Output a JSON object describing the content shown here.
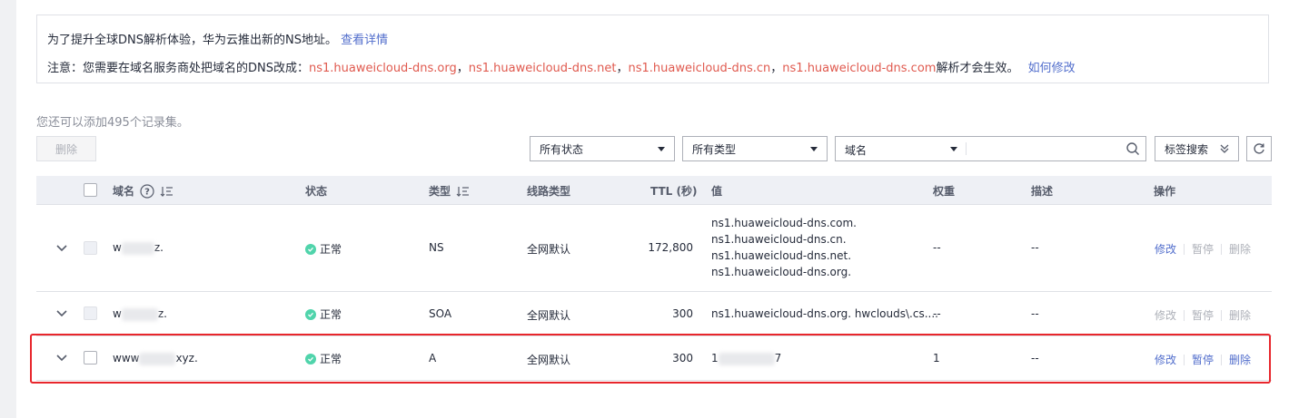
{
  "notice": {
    "line1_text": "为了提升全球DNS解析体验，华为云推出新的NS地址。",
    "line1_link": "查看详情",
    "line2_prefix": "注意：您需要在域名服务商处把域名的DNS改成：",
    "ns_servers": [
      "ns1.huaweicloud-dns.org",
      "ns1.huaweicloud-dns.net",
      "ns1.huaweicloud-dns.cn",
      "ns1.huaweicloud-dns.com"
    ],
    "separator": "，",
    "line2_suffix": "解析才会生效。",
    "line2_link": "如何修改"
  },
  "quota_text": "您还可以添加495个记录集。",
  "toolbar": {
    "delete_label": "删除",
    "status_filter": "所有状态",
    "type_filter": "所有类型",
    "search_field": "域名",
    "search_value": "",
    "tag_search_label": "标签搜索"
  },
  "table": {
    "headers": {
      "domain": "域名",
      "status": "状态",
      "type": "类型",
      "line": "线路类型",
      "ttl": "TTL (秒)",
      "value": "值",
      "weight": "权重",
      "desc": "描述",
      "ops": "操作"
    },
    "rows": [
      {
        "domain_prefix": "w",
        "domain_suffix": "z.",
        "status": "正常",
        "type": "NS",
        "line": "全网默认",
        "ttl": "172,800",
        "values": [
          "ns1.huaweicloud-dns.com.",
          "ns1.huaweicloud-dns.cn.",
          "ns1.huaweicloud-dns.net.",
          "ns1.huaweicloud-dns.org."
        ],
        "weight": "--",
        "desc": "--",
        "ops": {
          "edit": "修改",
          "pause": "暂停",
          "delete": "删除"
        }
      },
      {
        "domain_prefix": "w",
        "domain_suffix": "z.",
        "status": "正常",
        "type": "SOA",
        "line": "全网默认",
        "ttl": "300",
        "values": [
          "ns1.huaweicloud-dns.org. hwclouds\\.cs...."
        ],
        "weight": "--",
        "desc": "--",
        "ops": {
          "edit": "修改",
          "pause": "暂停",
          "delete": "删除"
        }
      },
      {
        "domain_prefix": "www",
        "domain_suffix": "xyz.",
        "status": "正常",
        "type": "A",
        "line": "全网默认",
        "ttl": "300",
        "value_prefix": "1",
        "value_suffix": "7",
        "weight": "1",
        "desc": "--",
        "ops": {
          "edit": "修改",
          "pause": "暂停",
          "delete": "删除"
        }
      }
    ]
  },
  "colors": {
    "accent": "#526ecc",
    "ns_red": "#e05a4f",
    "status_green": "#50d4ab",
    "highlight": "#e8262c"
  }
}
